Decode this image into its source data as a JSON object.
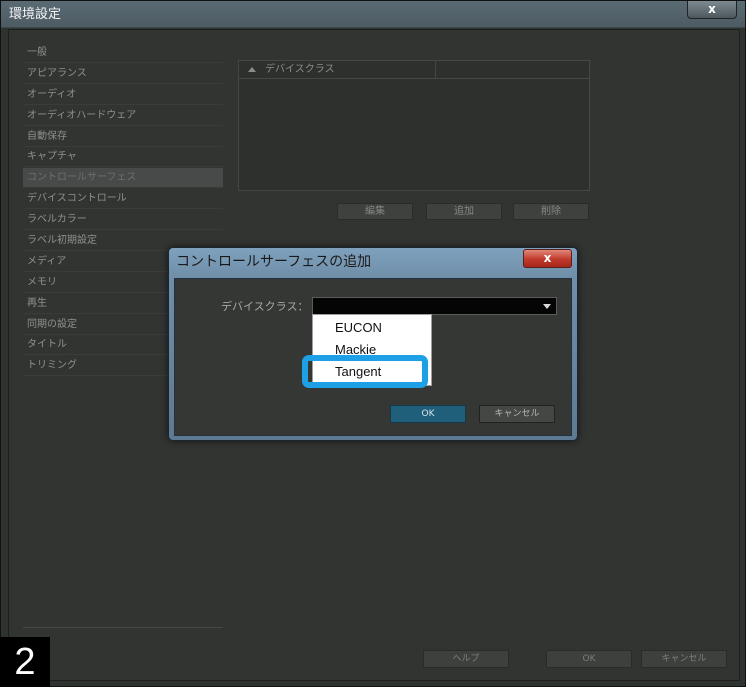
{
  "window": {
    "title": "環境設定",
    "close_label": "x"
  },
  "sidebar": {
    "items": [
      {
        "label": "一般"
      },
      {
        "label": "アピアランス"
      },
      {
        "label": "オーディオ"
      },
      {
        "label": "オーディオハードウェア"
      },
      {
        "label": "自動保存"
      },
      {
        "label": "キャプチャ"
      },
      {
        "label": "コントロールサーフェス",
        "selected": true
      },
      {
        "label": "デバイスコントロール"
      },
      {
        "label": "ラベルカラー"
      },
      {
        "label": "ラベル初期設定"
      },
      {
        "label": "メディア"
      },
      {
        "label": "メモリ"
      },
      {
        "label": "再生"
      },
      {
        "label": "同期の設定"
      },
      {
        "label": "タイトル"
      },
      {
        "label": "トリミング"
      }
    ]
  },
  "device_panel": {
    "column_header": "デバイスクラス",
    "edit_label": "編集",
    "add_label": "追加",
    "delete_label": "削除"
  },
  "dialog": {
    "title": "コントロールサーフェスの追加",
    "close_label": "x",
    "device_class_label": "デバイスクラス：",
    "selected_value": "",
    "options": [
      "EUCON",
      "Mackie",
      "Tangent"
    ],
    "highlighted_option": "Tangent",
    "ok_label": "OK",
    "cancel_label": "キャンセル"
  },
  "footer": {
    "help_label": "ヘルプ",
    "ok_label": "OK",
    "cancel_label": "キャンセル"
  },
  "step_badge": "2",
  "colors": {
    "highlight": "#1ea0e6",
    "dialog_ok_button": "#1f5f7a",
    "dialog_close_button": "#c03a2b"
  }
}
